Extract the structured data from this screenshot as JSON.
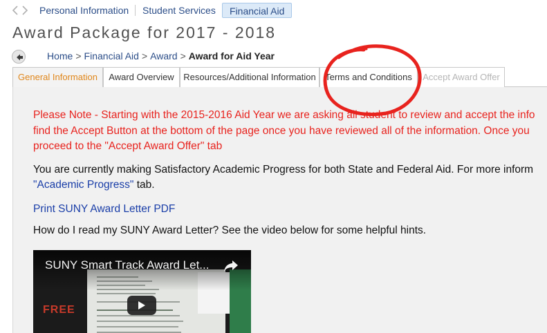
{
  "topnav": {
    "items": [
      {
        "label": "Personal Information"
      },
      {
        "label": "Student Services"
      },
      {
        "label": "Financial Aid"
      }
    ]
  },
  "page": {
    "title": "Award Package for 2017 - 2018"
  },
  "breadcrumb": {
    "items": [
      "Home",
      "Financial Aid",
      "Award"
    ],
    "current": "Award for Aid Year",
    "separator": ">"
  },
  "tabs": [
    {
      "label": "General Information"
    },
    {
      "label": "Award Overview"
    },
    {
      "label": "Resources/Additional Information"
    },
    {
      "label": "Terms and Conditions"
    },
    {
      "label": "Accept Award Offer"
    }
  ],
  "content": {
    "notice_line1": "Please Note - Starting with the 2015-2016 Aid Year we are asking all student to review and accept the info",
    "notice_line2": "find the Accept Button at the bottom of the page once you have reviewed all of the information. Once you",
    "notice_line3": "proceed to the \"Accept Award Offer\" tab",
    "sap_line1": "You are currently making Satisfactory Academic Progress for both State and Federal Aid. For more inform",
    "sap_link": "\"Academic Progress\"",
    "sap_suffix": " tab.",
    "print_link": "Print SUNY Award Letter PDF",
    "howto": "How do I read my SUNY Award Letter? See the video below for some helpful hints."
  },
  "video": {
    "title": "SUNY Smart Track Award Let...",
    "overlay_text": "FREE"
  },
  "colors": {
    "link": "#2b4d88",
    "notice": "#e8231e",
    "active_tab": "#e0861a",
    "annotation": "#e8231e"
  }
}
